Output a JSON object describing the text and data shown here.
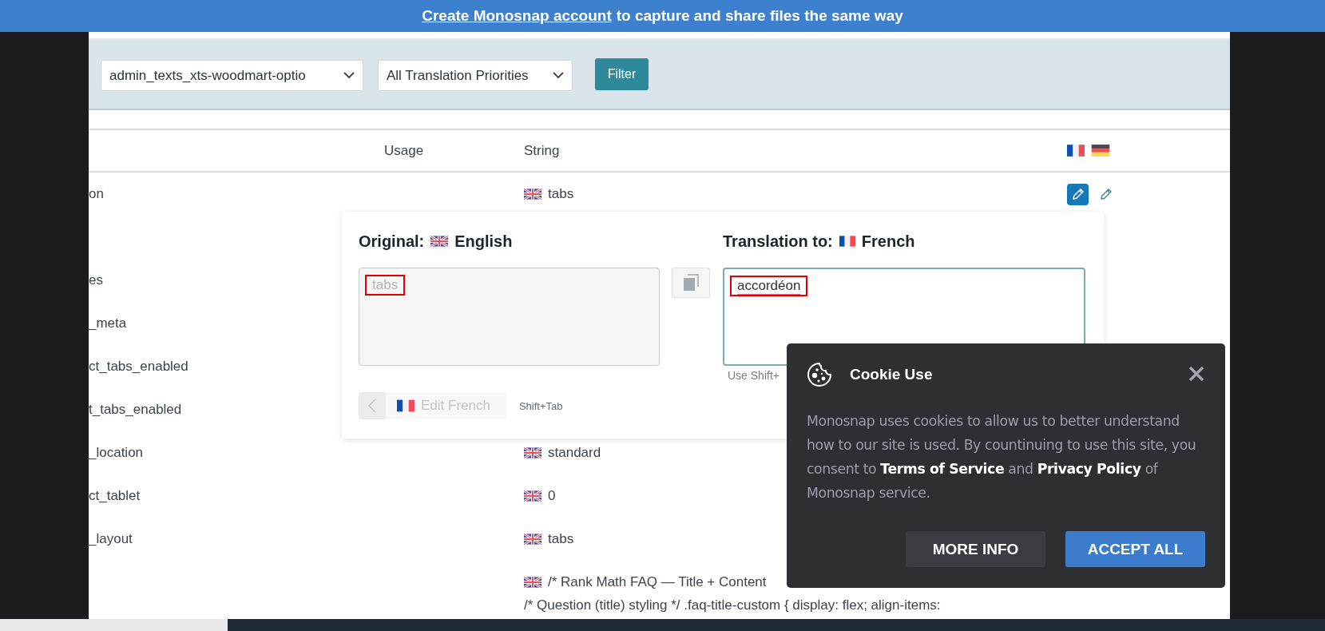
{
  "banner": {
    "link": "Create Monosnap account",
    "text": "to capture and share files the same way"
  },
  "filters": {
    "selects": [
      {
        "value": "admin_texts_xts-woodmart-optio"
      },
      {
        "value": "All Translation Priorities"
      }
    ],
    "button": "Filter"
  },
  "table": {
    "columns": [
      "Usage",
      "String"
    ],
    "rows": [
      {
        "name": "on",
        "string": "tabs",
        "edit_buttons": [
          {
            "selected": true
          },
          {
            "selected": false
          }
        ]
      },
      {},
      {
        "name": "es"
      },
      {
        "name": "_meta"
      },
      {
        "name": "ct_tabs_enabled"
      },
      {
        "name": "t_tabs_enabled"
      },
      {
        "name": "_location",
        "string": "standard"
      },
      {
        "name": "ct_tablet",
        "string": "0"
      },
      {
        "name": "_layout",
        "string": "tabs"
      },
      {
        "lines": [
          "/* Rank Math FAQ — Title + Content",
          "/* Question (title) styling */ .faq-title-custom { display: flex; align-items:"
        ]
      }
    ]
  },
  "editor": {
    "original_label": "Original:",
    "original_language": "English",
    "original_text": "tabs",
    "translation_label": "Translation to:",
    "translation_language": "French",
    "translation_text": "accordéon",
    "hint": "Use Shift+",
    "edit_button": {
      "label": "Edit French",
      "disabled": true
    },
    "back_disabled": true,
    "shortcut": "Shift+Tab"
  },
  "cookie": {
    "title": "Cookie Use",
    "body": [
      {
        "kind": "text",
        "text": "Monosnap uses cookies to allow us to better understand how to our site is used. By countinuing to use this site, you consent to "
      },
      {
        "kind": "link",
        "text": "Terms of Service"
      },
      {
        "kind": "text",
        "text": " and "
      },
      {
        "kind": "link",
        "text": "Privacy Policy"
      },
      {
        "kind": "text",
        "text": " of Monosnap service."
      }
    ],
    "buttons": [
      {
        "label": "MORE INFO",
        "kind": "secondary"
      },
      {
        "label": "ACCEPT ALL",
        "kind": "primary"
      }
    ]
  }
}
